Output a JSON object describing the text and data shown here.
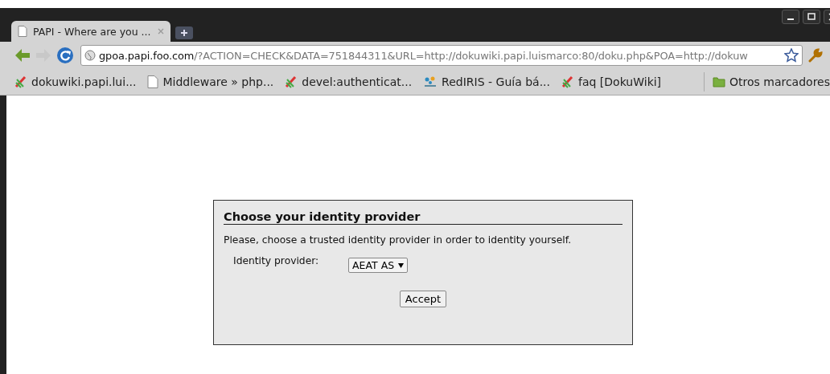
{
  "tabs": [
    {
      "title": "PAPI - Where are you ...",
      "selected": true
    }
  ],
  "address": {
    "host": "gpoa.papi.foo.com",
    "rest": "/?ACTION=CHECK&DATA=751844311&URL=http://dokuwiki.papi.luismarco:80/doku.php&POA=http://dokuw"
  },
  "bookmarks": [
    {
      "label": "dokuwiki.papi.lui...",
      "kind": "wiki"
    },
    {
      "label": "Middleware » php...",
      "kind": "page"
    },
    {
      "label": "devel:authenticat...",
      "kind": "wiki"
    },
    {
      "label": "RedIRIS - Guía bá...",
      "kind": "rediris"
    },
    {
      "label": "faq [DokuWiki]",
      "kind": "wiki"
    }
  ],
  "other_bookmarks": "Otros marcadores",
  "dialog": {
    "title": "Choose your identity provider",
    "text": "Please, choose a trusted identity provider in order to identity yourself.",
    "field_label": "Identity provider:",
    "select_value": "AEAT AS",
    "button": "Accept"
  }
}
